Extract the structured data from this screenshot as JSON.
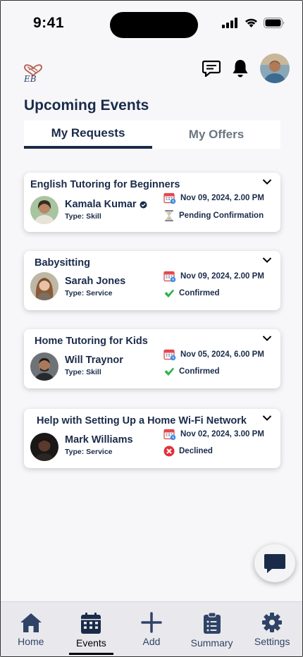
{
  "status": {
    "time": "9:41"
  },
  "page": {
    "title": "Upcoming Events"
  },
  "tabs": [
    {
      "label": "My Requests",
      "active": true
    },
    {
      "label": "My Offers",
      "active": false
    }
  ],
  "events": [
    {
      "title": "English Tutoring for Beginners",
      "name": "Kamala Kumar",
      "verified": true,
      "type": "Type: Skill",
      "date": "Nov 09, 2024, 2.00 PM",
      "status": "Pending Confirmation",
      "status_icon": "hourglass-icon"
    },
    {
      "title": "Babysitting",
      "name": "Sarah Jones",
      "verified": false,
      "type": "Type: Service",
      "date": "Nov 09, 2024, 2.00 PM",
      "status": "Confirmed",
      "status_icon": "checkmark-icon"
    },
    {
      "title": "Home Tutoring for Kids",
      "name": "Will Traynor",
      "verified": false,
      "type": "Type: Skill",
      "date": "Nov 05, 2024, 6.00 PM",
      "status": "Confirmed",
      "status_icon": "checkmark-icon"
    },
    {
      "title": "Help with Setting Up a Home Wi-Fi Network",
      "name": "Mark Williams",
      "verified": false,
      "type": "Type: Service",
      "date": "Nov 02, 2024, 3.00 PM",
      "status": "Declined",
      "status_icon": "declined-icon"
    }
  ],
  "nav": [
    {
      "label": "Home",
      "icon": "home-icon",
      "active": false
    },
    {
      "label": "Events",
      "icon": "calendar-icon",
      "active": true
    },
    {
      "label": "Add",
      "icon": "plus-icon",
      "active": false
    },
    {
      "label": "Summary",
      "icon": "clipboard-icon",
      "active": false
    },
    {
      "label": "Settings",
      "icon": "gear-icon",
      "active": false
    }
  ],
  "colors": {
    "navy": "#1a2b4a",
    "confirmed": "#2fb14a",
    "declined": "#e0313c"
  }
}
